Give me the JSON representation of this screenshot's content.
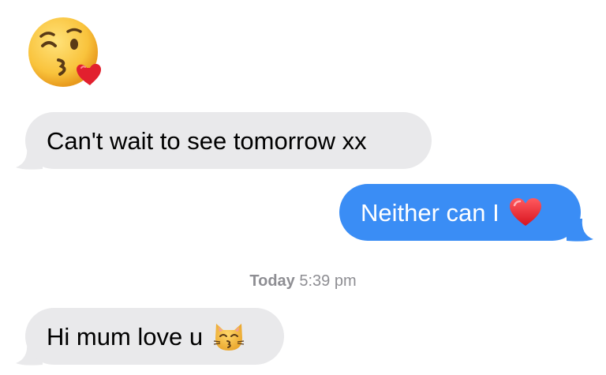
{
  "conversation": {
    "messages": [
      {
        "direction": "incoming",
        "type": "emoji",
        "emoji": "face-blowing-kiss-icon"
      },
      {
        "direction": "incoming",
        "type": "text",
        "text": "Can't wait to see tomorrow xx"
      },
      {
        "direction": "outgoing",
        "type": "text",
        "text": "Neither can I",
        "emoji": "red-heart-icon"
      },
      {
        "direction": "incoming",
        "type": "text",
        "text": "Hi mum love u",
        "emoji": "kissing-cat-icon"
      }
    ],
    "timestamp": {
      "day": "Today",
      "time": "5:39 pm"
    }
  },
  "colors": {
    "incoming_bubble": "#e9e9eb",
    "outgoing_bubble": "#3a8df5",
    "timestamp_text": "#8e8e93"
  }
}
